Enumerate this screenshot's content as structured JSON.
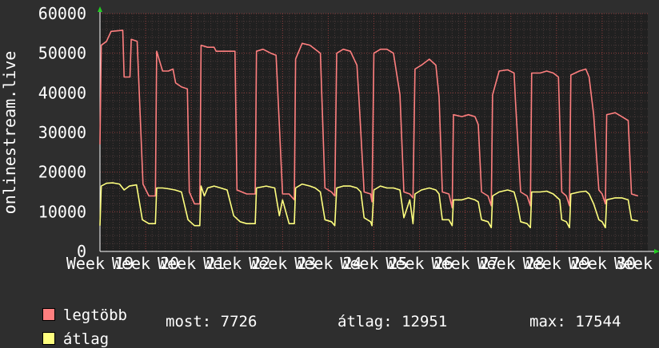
{
  "chart_data": {
    "type": "line",
    "ylabel": "onlinestream.live",
    "ylim": [
      0,
      60000
    ],
    "y_ticks": [
      "0",
      "10000",
      "20000",
      "30000",
      "40000",
      "50000",
      "60000"
    ],
    "x_tick_labels": [
      "Week 19",
      "Week 20",
      "Week 21",
      "Week 22",
      "Week 23",
      "Week 24",
      "Week 25",
      "Week 26",
      "Week 27",
      "Week 28",
      "Week 29",
      "Week 30",
      "Week 31"
    ],
    "x_label_left": "Week",
    "x_label_right": "31",
    "grid": true,
    "time_range_days": [
      0,
      84
    ],
    "series": [
      {
        "name": "legtöbb",
        "color": "#ff7f7f",
        "points": [
          [
            0,
            27000
          ],
          [
            0.2,
            52000
          ],
          [
            1,
            53000
          ],
          [
            1.7,
            55500
          ],
          [
            3.5,
            55800
          ],
          [
            3.7,
            44000
          ],
          [
            4.6,
            44000
          ],
          [
            4.8,
            53500
          ],
          [
            5.7,
            53000
          ],
          [
            6.6,
            17000
          ],
          [
            7.5,
            14000
          ],
          [
            8.5,
            14000
          ],
          [
            8.7,
            50500
          ],
          [
            9.6,
            45500
          ],
          [
            10.5,
            45500
          ],
          [
            11.2,
            46000
          ],
          [
            11.6,
            42500
          ],
          [
            12.5,
            41500
          ],
          [
            13.4,
            41000
          ],
          [
            13.7,
            15000
          ],
          [
            14.5,
            12000
          ],
          [
            15.3,
            12000
          ],
          [
            15.5,
            52000
          ],
          [
            16.5,
            51500
          ],
          [
            17.5,
            51500
          ],
          [
            17.8,
            50500
          ],
          [
            20.7,
            50500
          ],
          [
            21.0,
            15500
          ],
          [
            22.5,
            14500
          ],
          [
            23.8,
            14500
          ],
          [
            24.0,
            50500
          ],
          [
            25.0,
            51000
          ],
          [
            26.2,
            50000
          ],
          [
            27.0,
            49500
          ],
          [
            28.0,
            14500
          ],
          [
            29.0,
            14500
          ],
          [
            29.8,
            13000
          ],
          [
            30.0,
            48500
          ],
          [
            31.0,
            52500
          ],
          [
            32.2,
            52000
          ],
          [
            33.0,
            51000
          ],
          [
            33.8,
            50000
          ],
          [
            34.5,
            16000
          ],
          [
            35.5,
            15000
          ],
          [
            36.0,
            14000
          ],
          [
            36.3,
            50000
          ],
          [
            37.3,
            51000
          ],
          [
            38.4,
            50500
          ],
          [
            39.4,
            47000
          ],
          [
            39.7,
            39000
          ],
          [
            40.5,
            15000
          ],
          [
            41.5,
            14500
          ],
          [
            41.7,
            12500
          ],
          [
            42.0,
            50000
          ],
          [
            43.0,
            51000
          ],
          [
            44.0,
            51000
          ],
          [
            45.0,
            50000
          ],
          [
            46.0,
            39500
          ],
          [
            46.6,
            15000
          ],
          [
            47.5,
            14500
          ],
          [
            48.0,
            13500
          ],
          [
            48.3,
            46000
          ],
          [
            49.3,
            47000
          ],
          [
            50.5,
            48500
          ],
          [
            51.5,
            47000
          ],
          [
            52.0,
            39000
          ],
          [
            52.5,
            15000
          ],
          [
            53.5,
            14500
          ],
          [
            54.0,
            11000
          ],
          [
            54.2,
            34500
          ],
          [
            55.5,
            34000
          ],
          [
            56.5,
            34500
          ],
          [
            57.5,
            34000
          ],
          [
            58.0,
            32000
          ],
          [
            58.5,
            15000
          ],
          [
            59.5,
            14000
          ],
          [
            60.0,
            11500
          ],
          [
            60.2,
            39500
          ],
          [
            61.2,
            45500
          ],
          [
            62.5,
            45800
          ],
          [
            63.5,
            45000
          ],
          [
            63.7,
            38000
          ],
          [
            64.5,
            15000
          ],
          [
            65.5,
            14000
          ],
          [
            66.0,
            11500
          ],
          [
            66.2,
            45000
          ],
          [
            67.5,
            45000
          ],
          [
            68.5,
            45500
          ],
          [
            69.5,
            45000
          ],
          [
            70.3,
            44000
          ],
          [
            70.8,
            15000
          ],
          [
            71.5,
            14000
          ],
          [
            72.0,
            11500
          ],
          [
            72.2,
            44500
          ],
          [
            73.5,
            45500
          ],
          [
            74.5,
            46000
          ],
          [
            75.0,
            44000
          ],
          [
            75.7,
            34500
          ],
          [
            76.5,
            15500
          ],
          [
            77.0,
            14500
          ],
          [
            77.5,
            12000
          ],
          [
            77.7,
            34500
          ],
          [
            79.0,
            35000
          ],
          [
            80.0,
            34000
          ],
          [
            81.0,
            33000
          ],
          [
            81.5,
            14500
          ],
          [
            82.5,
            14000
          ]
        ]
      },
      {
        "name": "átlag",
        "color": "#ffff7f",
        "points": [
          [
            0,
            6500
          ],
          [
            0.2,
            16500
          ],
          [
            1,
            17200
          ],
          [
            2,
            17300
          ],
          [
            3,
            17000
          ],
          [
            3.7,
            15500
          ],
          [
            4.5,
            16500
          ],
          [
            5.6,
            16800
          ],
          [
            6.5,
            8000
          ],
          [
            7.5,
            7000
          ],
          [
            8.5,
            7000
          ],
          [
            8.7,
            16000
          ],
          [
            9.6,
            16000
          ],
          [
            10.5,
            15800
          ],
          [
            11.5,
            15500
          ],
          [
            12.5,
            15000
          ],
          [
            13.5,
            8000
          ],
          [
            14.5,
            6500
          ],
          [
            15.3,
            6500
          ],
          [
            15.5,
            16500
          ],
          [
            16.0,
            14000
          ],
          [
            16.5,
            16000
          ],
          [
            17.5,
            16500
          ],
          [
            18.5,
            16000
          ],
          [
            19.5,
            15500
          ],
          [
            20.5,
            9000
          ],
          [
            21.5,
            7500
          ],
          [
            22.5,
            7000
          ],
          [
            23.8,
            7000
          ],
          [
            24.0,
            16000
          ],
          [
            25.5,
            16500
          ],
          [
            26.8,
            16000
          ],
          [
            27.5,
            9000
          ],
          [
            28.0,
            13000
          ],
          [
            29.0,
            7000
          ],
          [
            29.8,
            7000
          ],
          [
            30.0,
            16000
          ],
          [
            31.0,
            17000
          ],
          [
            32.2,
            16500
          ],
          [
            33.0,
            16000
          ],
          [
            33.8,
            15000
          ],
          [
            34.5,
            8000
          ],
          [
            35.5,
            7500
          ],
          [
            36.0,
            6500
          ],
          [
            36.3,
            16000
          ],
          [
            37.3,
            16500
          ],
          [
            38.4,
            16500
          ],
          [
            39.4,
            16000
          ],
          [
            40.0,
            15000
          ],
          [
            40.5,
            8500
          ],
          [
            41.5,
            7500
          ],
          [
            41.7,
            6500
          ],
          [
            42.0,
            15500
          ],
          [
            43.0,
            16500
          ],
          [
            44.0,
            16000
          ],
          [
            45.0,
            16000
          ],
          [
            46.0,
            15500
          ],
          [
            46.6,
            8500
          ],
          [
            47.5,
            13000
          ],
          [
            48.0,
            7000
          ],
          [
            48.3,
            14500
          ],
          [
            49.3,
            15500
          ],
          [
            50.5,
            16000
          ],
          [
            51.5,
            15500
          ],
          [
            52.0,
            14500
          ],
          [
            52.5,
            8000
          ],
          [
            53.5,
            8000
          ],
          [
            54.0,
            6500
          ],
          [
            54.2,
            13000
          ],
          [
            55.5,
            13000
          ],
          [
            56.5,
            13500
          ],
          [
            57.5,
            13000
          ],
          [
            58.0,
            12500
          ],
          [
            58.5,
            8000
          ],
          [
            59.5,
            7500
          ],
          [
            60.0,
            6000
          ],
          [
            60.2,
            14000
          ],
          [
            61.2,
            15000
          ],
          [
            62.5,
            15500
          ],
          [
            63.5,
            15000
          ],
          [
            64.0,
            12000
          ],
          [
            64.5,
            7500
          ],
          [
            65.5,
            7000
          ],
          [
            66.0,
            6000
          ],
          [
            66.2,
            15000
          ],
          [
            67.5,
            15000
          ],
          [
            68.5,
            15200
          ],
          [
            69.5,
            14500
          ],
          [
            70.5,
            13000
          ],
          [
            70.8,
            8000
          ],
          [
            71.5,
            7500
          ],
          [
            72.0,
            6000
          ],
          [
            72.2,
            14500
          ],
          [
            73.5,
            15000
          ],
          [
            74.5,
            15200
          ],
          [
            75.0,
            14500
          ],
          [
            75.7,
            12000
          ],
          [
            76.5,
            8000
          ],
          [
            77.0,
            7500
          ],
          [
            77.5,
            6000
          ],
          [
            77.7,
            13000
          ],
          [
            79.0,
            13500
          ],
          [
            80.0,
            13500
          ],
          [
            81.0,
            13000
          ],
          [
            81.5,
            8000
          ],
          [
            82.5,
            7700
          ]
        ]
      }
    ]
  },
  "legend": {
    "max_label": "legtöbb",
    "avg_label": "átlag",
    "max_color": "#ff7f7f",
    "avg_color": "#ffff7f"
  },
  "stats": {
    "current": "most: 7726",
    "average": "átlag: 12951",
    "maximum": "max: 17544"
  }
}
